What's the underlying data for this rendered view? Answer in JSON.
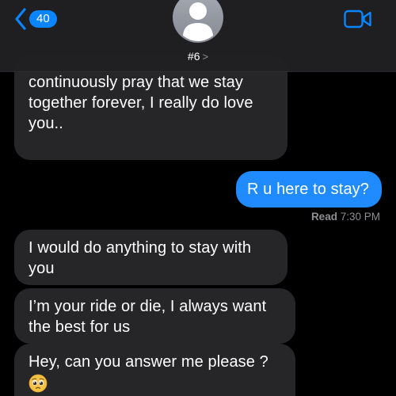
{
  "header": {
    "back_count": "40",
    "contact_name": "#6",
    "contact_chevron": ">"
  },
  "messages": [
    {
      "direction": "incoming",
      "text": "continuously pray that we stay together forever, I really do love you.."
    },
    {
      "direction": "outgoing",
      "text": "R u here to stay?"
    },
    {
      "direction": "incoming",
      "text": "I would do anything to stay with you"
    },
    {
      "direction": "incoming",
      "text": "I’m your ride or die, I always want the best for us"
    },
    {
      "direction": "incoming",
      "text": "Hey, can you answer me please ?",
      "emoji": "pleading-face"
    }
  ],
  "receipt": {
    "status": "Read",
    "time": "7:30 PM"
  },
  "colors": {
    "accent": "#0a84ff",
    "outgoing_bubble": "#1f8bff",
    "incoming_bubble": "#262629",
    "background": "#000000"
  },
  "icons": [
    "back-chevron-icon",
    "person-avatar-icon",
    "video-camera-icon",
    "pleading-face-emoji"
  ]
}
